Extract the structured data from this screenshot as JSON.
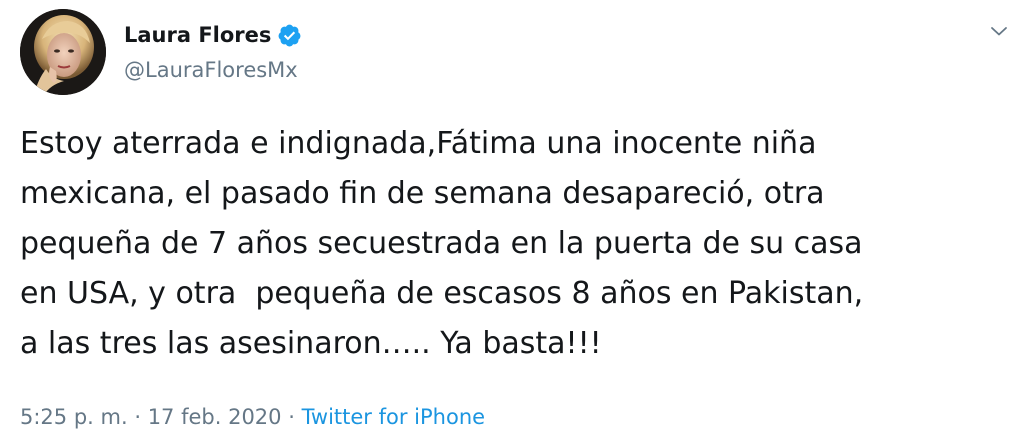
{
  "author": {
    "name": "Laura Flores",
    "handle": "@LauraFloresMx",
    "verified": true,
    "avatar_icon": "profile-photo-icon"
  },
  "tweet": {
    "lines": [
      "Estoy aterrada e indignada,Fátima una inocente niña",
      "mexicana, el pasado fin de semana desapareció, otra",
      "pequeña de 7 años secuestrada en la puerta de su casa",
      "en USA, y otra  pequeña de escasos 8 años en Pakistan,",
      "a las tres las asesinaron….. Ya basta!!!"
    ]
  },
  "meta": {
    "time": "5:25 p. m.",
    "separator1": " · ",
    "date": "17 feb. 2020",
    "separator2": " · ",
    "source": "Twitter for iPhone"
  },
  "colors": {
    "text": "#14171a",
    "secondary": "#657786",
    "link": "#1b95e0",
    "verified": "#1da1f2"
  },
  "menu_icon": "chevron-down-icon"
}
